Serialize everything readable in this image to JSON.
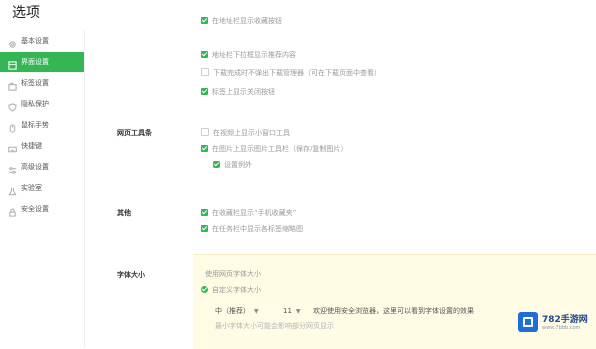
{
  "window": {
    "title": "选项"
  },
  "sidebar": {
    "items": [
      {
        "label": "基本设置",
        "icon": "gear-icon"
      },
      {
        "label": "界面设置",
        "icon": "layout-icon",
        "active": true
      },
      {
        "label": "标签设置",
        "icon": "tab-icon"
      },
      {
        "label": "隐私保护",
        "icon": "shield-icon"
      },
      {
        "label": "鼠标手势",
        "icon": "mouse-icon"
      },
      {
        "label": "快捷键",
        "icon": "keyboard-icon"
      },
      {
        "label": "高级设置",
        "icon": "sliders-icon"
      },
      {
        "label": "实验室",
        "icon": "flask-icon"
      },
      {
        "label": "安全设置",
        "icon": "lock-icon"
      }
    ]
  },
  "main": {
    "top_options": [
      {
        "label": "在地址栏显示收藏按钮",
        "checked": true,
        "faded": true
      },
      {
        "label": "地址栏下拉框显示推荐内容",
        "checked": true,
        "faded": true
      },
      {
        "label": "下载完成时不弹出下载管理器（可在下载页面中查看）",
        "checked": false,
        "faded": true
      },
      {
        "label": "标签上显示关闭按钮",
        "checked": true,
        "faded": true
      }
    ],
    "toolbar_section": {
      "label": "网页工具条",
      "options": [
        {
          "label": "在视频上显示小窗口工具",
          "checked": false,
          "faded": true
        },
        {
          "label": "在图片上显示图片工具栏（保存/复制图片）",
          "checked": true,
          "faded": true
        }
      ],
      "sub_option": "设置例外"
    },
    "other_section": {
      "label": "其他",
      "options": [
        {
          "label": "在收藏栏显示“手机收藏夹”",
          "checked": true,
          "faded": true
        },
        {
          "label": "在任务栏中显示各标签缩略图",
          "checked": true,
          "faded": true
        }
      ]
    },
    "font_section": {
      "label": "字体大小",
      "option_default": "使用网页字体大小",
      "option_custom": "自定义字体大小",
      "size_select": "中（推荐）",
      "size_number": "11",
      "hint": "欢迎使用安全浏览器，这里可以看到字体设置的效果",
      "extra_line": "最小字体大小可能会影响部分网页显示"
    }
  },
  "watermark": {
    "brand": "782手游网",
    "url": "www.7bbb.com"
  }
}
